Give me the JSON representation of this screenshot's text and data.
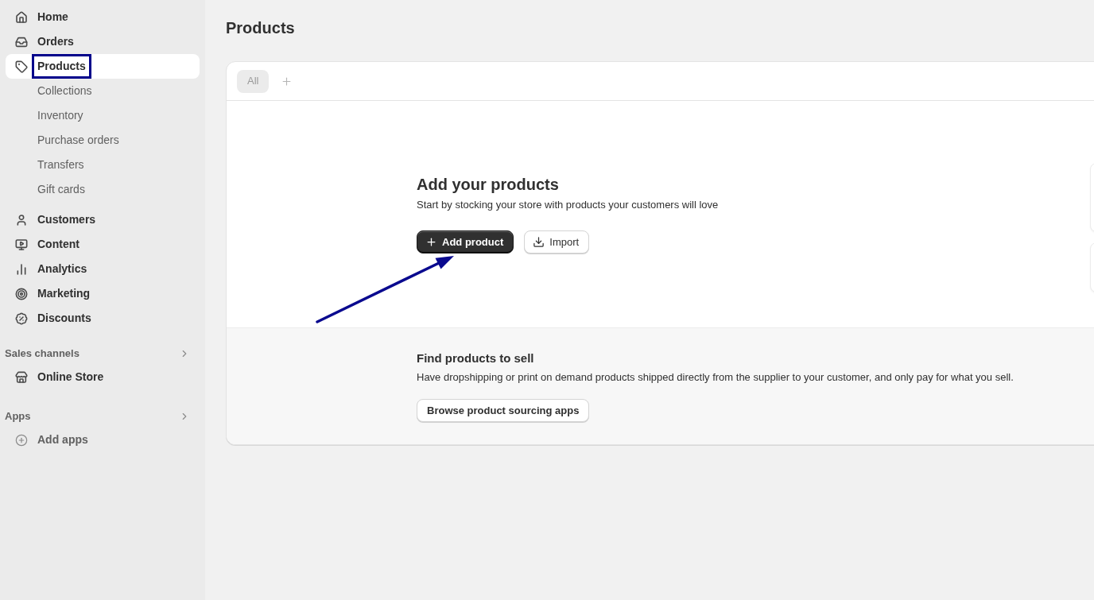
{
  "sidebar": {
    "items": [
      {
        "label": "Home",
        "selected": false,
        "highlighted": false
      },
      {
        "label": "Orders",
        "selected": false,
        "highlighted": false
      },
      {
        "label": "Products",
        "selected": true,
        "highlighted": true,
        "children": [
          {
            "label": "Collections",
            "selected": false
          },
          {
            "label": "Inventory",
            "selected": false
          },
          {
            "label": "Purchase orders",
            "selected": false
          },
          {
            "label": "Transfers",
            "selected": false
          },
          {
            "label": "Gift cards",
            "selected": false
          }
        ]
      },
      {
        "label": "Customers",
        "selected": false,
        "highlighted": false
      },
      {
        "label": "Content",
        "selected": false,
        "highlighted": false
      },
      {
        "label": "Analytics",
        "selected": false,
        "highlighted": false
      },
      {
        "label": "Marketing",
        "selected": false,
        "highlighted": false
      },
      {
        "label": "Discounts",
        "selected": false,
        "highlighted": false
      }
    ],
    "sections": [
      {
        "title": "Sales channels",
        "items": [
          {
            "label": "Online Store",
            "kind": "link",
            "selected": false
          }
        ]
      },
      {
        "title": "Apps",
        "items": [
          {
            "label": "Add apps",
            "kind": "action",
            "selected": false
          }
        ]
      }
    ]
  },
  "page": {
    "title": "Products",
    "tabs": [
      {
        "label": "All",
        "selected": true
      }
    ],
    "empty_state": {
      "heading": "Add your products",
      "description": "Start by stocking your store with products your customers will love",
      "buttons": [
        {
          "label": "Add product",
          "kind": "primary",
          "pointer_arrow": true
        },
        {
          "label": "Import",
          "kind": "secondary",
          "pointer_arrow": false
        }
      ]
    },
    "sourcing": {
      "heading": "Find products to sell",
      "description": "Have dropshipping or print on demand products shipped directly from the supplier to your customer, and only pay for what you sell.",
      "button": "Browse product sourcing apps"
    }
  }
}
